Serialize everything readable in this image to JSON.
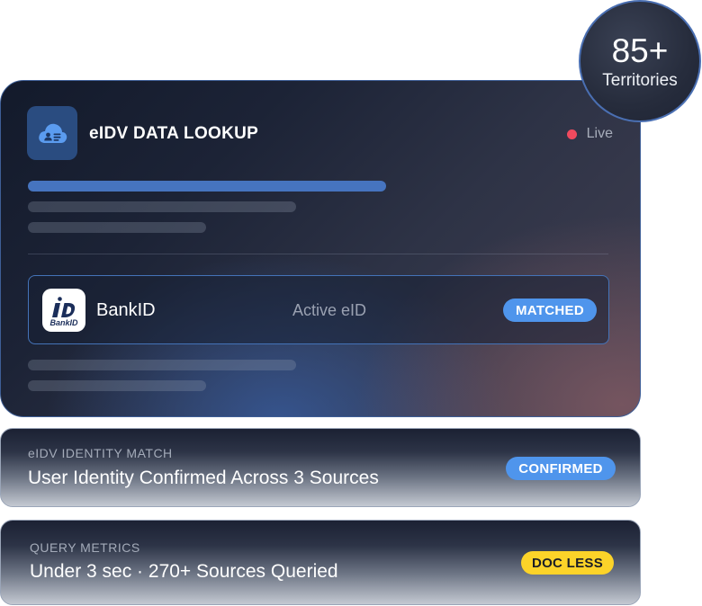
{
  "lookup_card": {
    "title": "eIDV DATA LOOKUP",
    "status": "Live",
    "provider": {
      "name": "BankID",
      "logo_text": "BankID",
      "status": "Active eID",
      "badge": "MATCHED"
    }
  },
  "territories": {
    "count": "85+",
    "label": "Territories"
  },
  "identity_match": {
    "label": "eIDV IDENTITY MATCH",
    "text": "User Identity Confirmed Across 3 Sources",
    "badge": "CONFIRMED"
  },
  "query_metrics": {
    "label": "QUERY METRICS",
    "text": "Under 3 sec · 270+ Sources Queried",
    "badge": "DOC LESS"
  },
  "colors": {
    "accent_blue": "#4f95ec",
    "live_red": "#f04a5e",
    "badge_yellow": "#fcd329"
  },
  "icons": {
    "header": "cloud-id-icon",
    "live": "live-dot-icon",
    "provider": "bankid-logo-icon"
  }
}
